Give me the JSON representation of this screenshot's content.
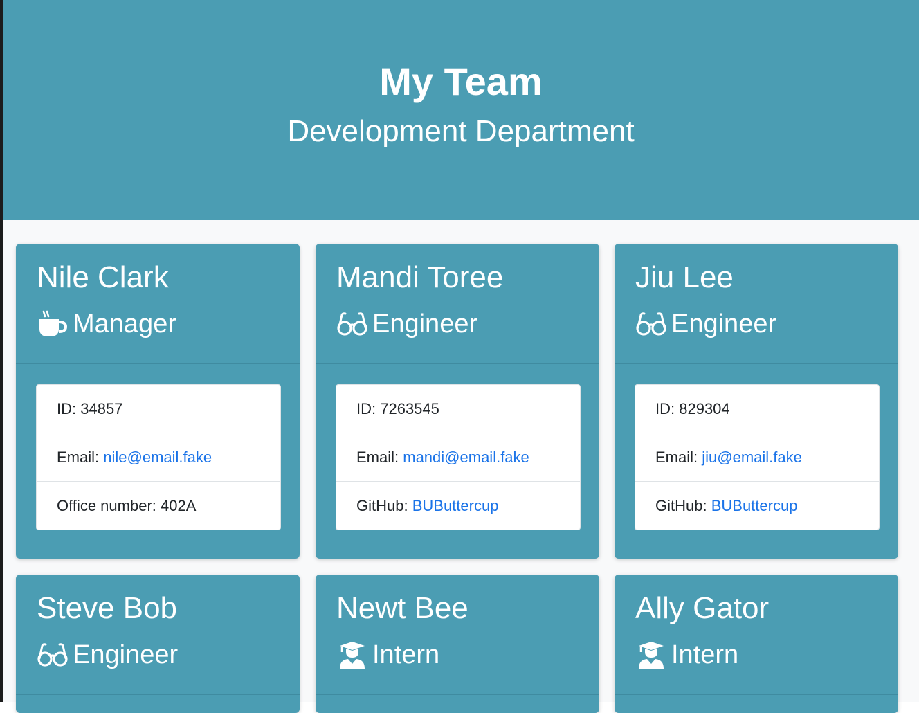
{
  "header": {
    "title": "My Team",
    "subtitle": "Development Department"
  },
  "employees": [
    {
      "name": "Nile Clark",
      "role": "Manager",
      "icon": "coffee-icon",
      "id_label": "ID: ",
      "id": "34857",
      "email_label": "Email: ",
      "email": "nile@email.fake",
      "extra_label": "Office number: ",
      "extra_value": "402A"
    },
    {
      "name": "Mandi Toree",
      "role": "Engineer",
      "icon": "glasses-icon",
      "id_label": "ID: ",
      "id": "7263545",
      "email_label": "Email: ",
      "email": "mandi@email.fake",
      "extra_label": "GitHub: ",
      "extra_value": "BUButtercup"
    },
    {
      "name": "Jiu Lee",
      "role": "Engineer",
      "icon": "glasses-icon",
      "id_label": "ID: ",
      "id": "829304",
      "email_label": "Email: ",
      "email": "jiu@email.fake",
      "extra_label": "GitHub: ",
      "extra_value": "BUButtercup"
    },
    {
      "name": "Steve Bob",
      "role": "Engineer",
      "icon": "glasses-icon"
    },
    {
      "name": "Newt Bee",
      "role": "Intern",
      "icon": "graduate-icon"
    },
    {
      "name": "Ally Gator",
      "role": "Intern",
      "icon": "graduate-icon"
    }
  ],
  "colors": {
    "primary": "#4b9db3",
    "link": "#1a73e8",
    "text": "#212529",
    "background": "#f8f9fa"
  }
}
